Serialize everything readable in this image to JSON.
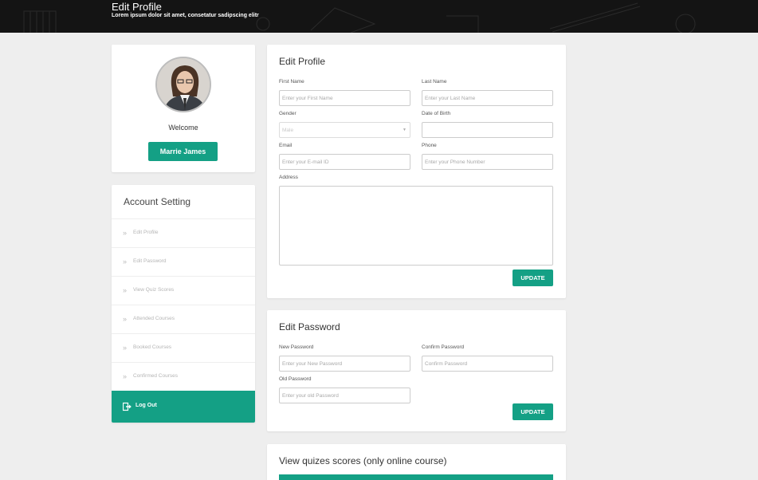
{
  "banner": {
    "title": "Edit Profile",
    "subtitle": "Lorem ipsum dolor sit amet, consetatur sadipscing elitr"
  },
  "profile": {
    "welcome": "Welcome",
    "name": "Marrie James"
  },
  "account": {
    "title": "Account Setting",
    "items": [
      {
        "label": "Edit Profile"
      },
      {
        "label": "Edit Password"
      },
      {
        "label": "View Quiz Scores"
      },
      {
        "label": "Attended Courses"
      },
      {
        "label": "Booked Courses"
      },
      {
        "label": "Confirmed Courses"
      }
    ],
    "logout": "Log Out",
    "chevron": "»"
  },
  "edit_profile": {
    "title": "Edit Profile",
    "first_name": {
      "label": "First Name",
      "placeholder": "Enter your First Name"
    },
    "last_name": {
      "label": "Last Name",
      "placeholder": "Enter your Last Name"
    },
    "gender": {
      "label": "Gender",
      "value": "Male"
    },
    "dob": {
      "label": "Date of Birth",
      "placeholder": ""
    },
    "email": {
      "label": "Email",
      "placeholder": "Enter your E-mail ID"
    },
    "phone": {
      "label": "Phone",
      "placeholder": "Enter your Phone Number"
    },
    "address": {
      "label": "Address"
    },
    "update": "UPDATE"
  },
  "edit_password": {
    "title": "Edit Password",
    "new": {
      "label": "New Password",
      "placeholder": "Enter your New Password"
    },
    "confirm": {
      "label": "Confirm Password",
      "placeholder": "Confirm Password"
    },
    "old": {
      "label": "Old Password",
      "placeholder": "Enter your old Password"
    },
    "update": "UPDATE"
  },
  "scores": {
    "title": "View quizes scores (only online course)"
  },
  "colors": {
    "accent": "#14a085",
    "banner": "#141414",
    "background": "#eeeeee"
  }
}
